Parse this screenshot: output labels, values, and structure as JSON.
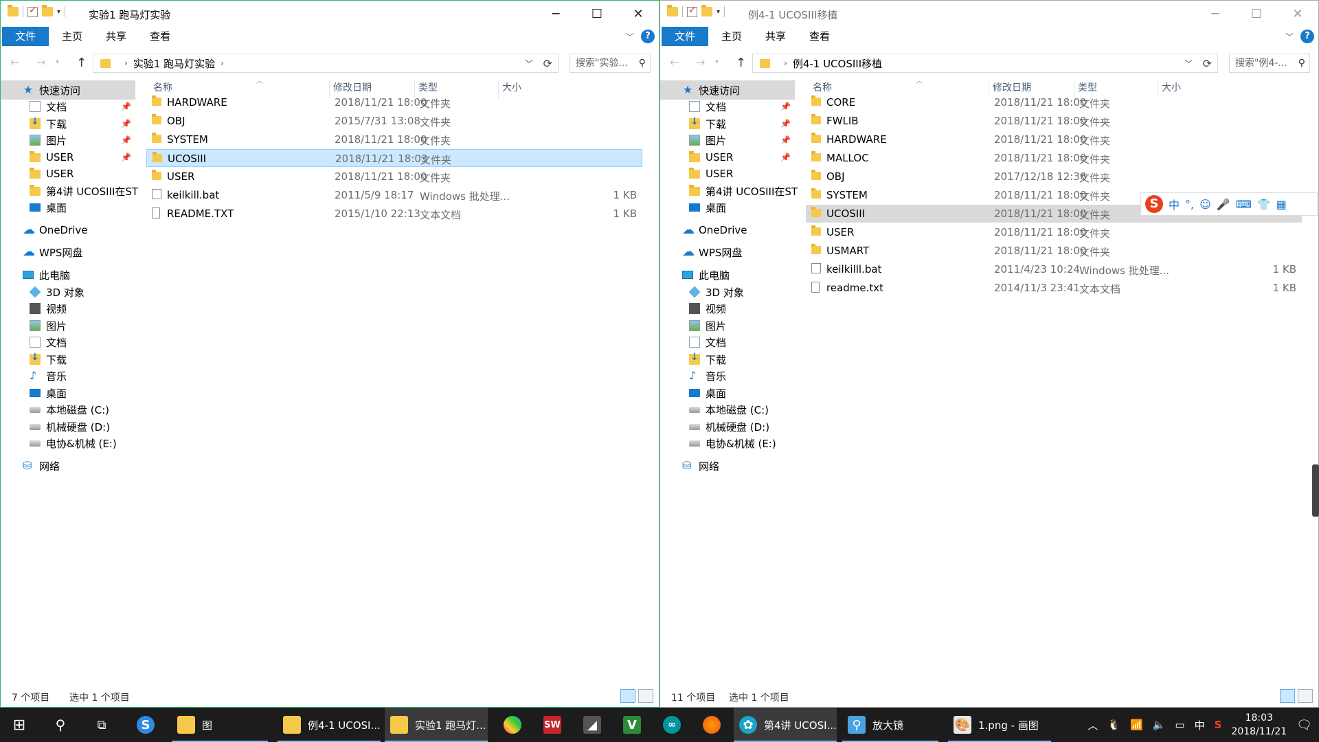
{
  "left": {
    "title": "实验1 跑马灯实验",
    "tabs": [
      "文件",
      "主页",
      "共享",
      "查看"
    ],
    "breadcrumb": "实验1 跑马灯实验",
    "search_placeholder": "搜索\"实验...",
    "columns": [
      "名称",
      "修改日期",
      "类型",
      "大小"
    ],
    "files": [
      {
        "name": "HARDWARE",
        "date": "2018/11/21 18:00",
        "type": "文件夹",
        "size": "",
        "kind": "folder"
      },
      {
        "name": "OBJ",
        "date": "2015/7/31 13:08",
        "type": "文件夹",
        "size": "",
        "kind": "folder"
      },
      {
        "name": "SYSTEM",
        "date": "2018/11/21 18:00",
        "type": "文件夹",
        "size": "",
        "kind": "folder"
      },
      {
        "name": "UCOSIII",
        "date": "2018/11/21 18:03",
        "type": "文件夹",
        "size": "",
        "kind": "folder"
      },
      {
        "name": "USER",
        "date": "2018/11/21 18:00",
        "type": "文件夹",
        "size": "",
        "kind": "folder"
      },
      {
        "name": "keilkill.bat",
        "date": "2011/5/9 18:17",
        "type": "Windows 批处理...",
        "size": "1 KB",
        "kind": "bat"
      },
      {
        "name": "README.TXT",
        "date": "2015/1/10 22:13",
        "type": "文本文档",
        "size": "1 KB",
        "kind": "txt"
      }
    ],
    "status_count": "7 个项目",
    "status_selected": "选中 1 个项目"
  },
  "right": {
    "title": "例4-1 UCOSIII移植",
    "tabs": [
      "文件",
      "主页",
      "共享",
      "查看"
    ],
    "breadcrumb": "例4-1 UCOSIII移植",
    "search_placeholder": "搜索\"例4-...",
    "columns": [
      "名称",
      "修改日期",
      "类型",
      "大小"
    ],
    "files": [
      {
        "name": "CORE",
        "date": "2018/11/21 18:00",
        "type": "文件夹",
        "size": "",
        "kind": "folder"
      },
      {
        "name": "FWLIB",
        "date": "2018/11/21 18:00",
        "type": "文件夹",
        "size": "",
        "kind": "folder"
      },
      {
        "name": "HARDWARE",
        "date": "2018/11/21 18:00",
        "type": "文件夹",
        "size": "",
        "kind": "folder"
      },
      {
        "name": "MALLOC",
        "date": "2018/11/21 18:00",
        "type": "文件夹",
        "size": "",
        "kind": "folder"
      },
      {
        "name": "OBJ",
        "date": "2017/12/18 12:36",
        "type": "文件夹",
        "size": "",
        "kind": "folder"
      },
      {
        "name": "SYSTEM",
        "date": "2018/11/21 18:00",
        "type": "文件夹",
        "size": "",
        "kind": "folder"
      },
      {
        "name": "UCOSIII",
        "date": "2018/11/21 18:00",
        "type": "文件夹",
        "size": "",
        "kind": "folder"
      },
      {
        "name": "USER",
        "date": "2018/11/21 18:00",
        "type": "文件夹",
        "size": "",
        "kind": "folder"
      },
      {
        "name": "USMART",
        "date": "2018/11/21 18:00",
        "type": "文件夹",
        "size": "",
        "kind": "folder"
      },
      {
        "name": "keilkilll.bat",
        "date": "2011/4/23 10:24",
        "type": "Windows 批处理...",
        "size": "1 KB",
        "kind": "bat"
      },
      {
        "name": "readme.txt",
        "date": "2014/11/3 23:41",
        "type": "文本文档",
        "size": "1 KB",
        "kind": "txt"
      }
    ],
    "status_count": "11 个项目",
    "status_selected": "选中 1 个项目"
  },
  "navpane": [
    {
      "label": "快速访问",
      "icon": "star-icon",
      "indent": 0,
      "pinned": false
    },
    {
      "label": "文档",
      "icon": "documents-icon",
      "indent": 1,
      "pinned": true
    },
    {
      "label": "下载",
      "icon": "downloads-icon",
      "indent": 1,
      "pinned": true
    },
    {
      "label": "图片",
      "icon": "pictures-icon",
      "indent": 1,
      "pinned": true
    },
    {
      "label": "USER",
      "icon": "folder-icon",
      "indent": 1,
      "pinned": true
    },
    {
      "label": "USER",
      "icon": "folder-icon",
      "indent": 1,
      "pinned": false
    },
    {
      "label": "第4讲 UCOSIII在ST",
      "icon": "folder-icon",
      "indent": 1,
      "pinned": false
    },
    {
      "label": "桌面",
      "icon": "desktop-icon",
      "indent": 1,
      "pinned": false
    },
    {
      "label": "OneDrive",
      "icon": "onedrive-icon",
      "indent": 0,
      "pinned": false
    },
    {
      "label": "WPS网盘",
      "icon": "wps-cloud-icon",
      "indent": 0,
      "pinned": false
    },
    {
      "label": "此电脑",
      "icon": "this-pc-icon",
      "indent": 0,
      "pinned": false
    },
    {
      "label": "3D 对象",
      "icon": "3d-objects-icon",
      "indent": 1,
      "pinned": false
    },
    {
      "label": "视频",
      "icon": "videos-icon",
      "indent": 1,
      "pinned": false
    },
    {
      "label": "图片",
      "icon": "pictures-icon",
      "indent": 1,
      "pinned": false
    },
    {
      "label": "文档",
      "icon": "documents-icon",
      "indent": 1,
      "pinned": false
    },
    {
      "label": "下载",
      "icon": "downloads-icon",
      "indent": 1,
      "pinned": false
    },
    {
      "label": "音乐",
      "icon": "music-icon",
      "indent": 1,
      "pinned": false
    },
    {
      "label": "桌面",
      "icon": "desktop-icon",
      "indent": 1,
      "pinned": false
    },
    {
      "label": "本地磁盘 (C:)",
      "icon": "drive-icon",
      "indent": 1,
      "pinned": false
    },
    {
      "label": "机械硬盘 (D:)",
      "icon": "drive-icon",
      "indent": 1,
      "pinned": false
    },
    {
      "label": "电协&机械 (E:)",
      "icon": "drive-icon",
      "indent": 1,
      "pinned": false
    },
    {
      "label": "网络",
      "icon": "network-icon",
      "indent": 0,
      "pinned": false
    }
  ],
  "ime": {
    "mode": "中",
    "punct": "°,"
  },
  "taskbar": {
    "items": [
      {
        "label": "图",
        "icon": "folder-icon"
      },
      {
        "label": "例4-1 UCOSI...",
        "icon": "folder-icon"
      },
      {
        "label": "实验1 跑马灯...",
        "icon": "folder-icon"
      },
      {
        "label": "第4讲 UCOSI...",
        "icon": "video-player-icon"
      },
      {
        "label": "放大镜",
        "icon": "magnifier-icon"
      },
      {
        "label": "1.png - 画图",
        "icon": "paint-icon"
      }
    ],
    "tray_lang": "中",
    "time": "18:03",
    "date": "2018/11/21"
  }
}
